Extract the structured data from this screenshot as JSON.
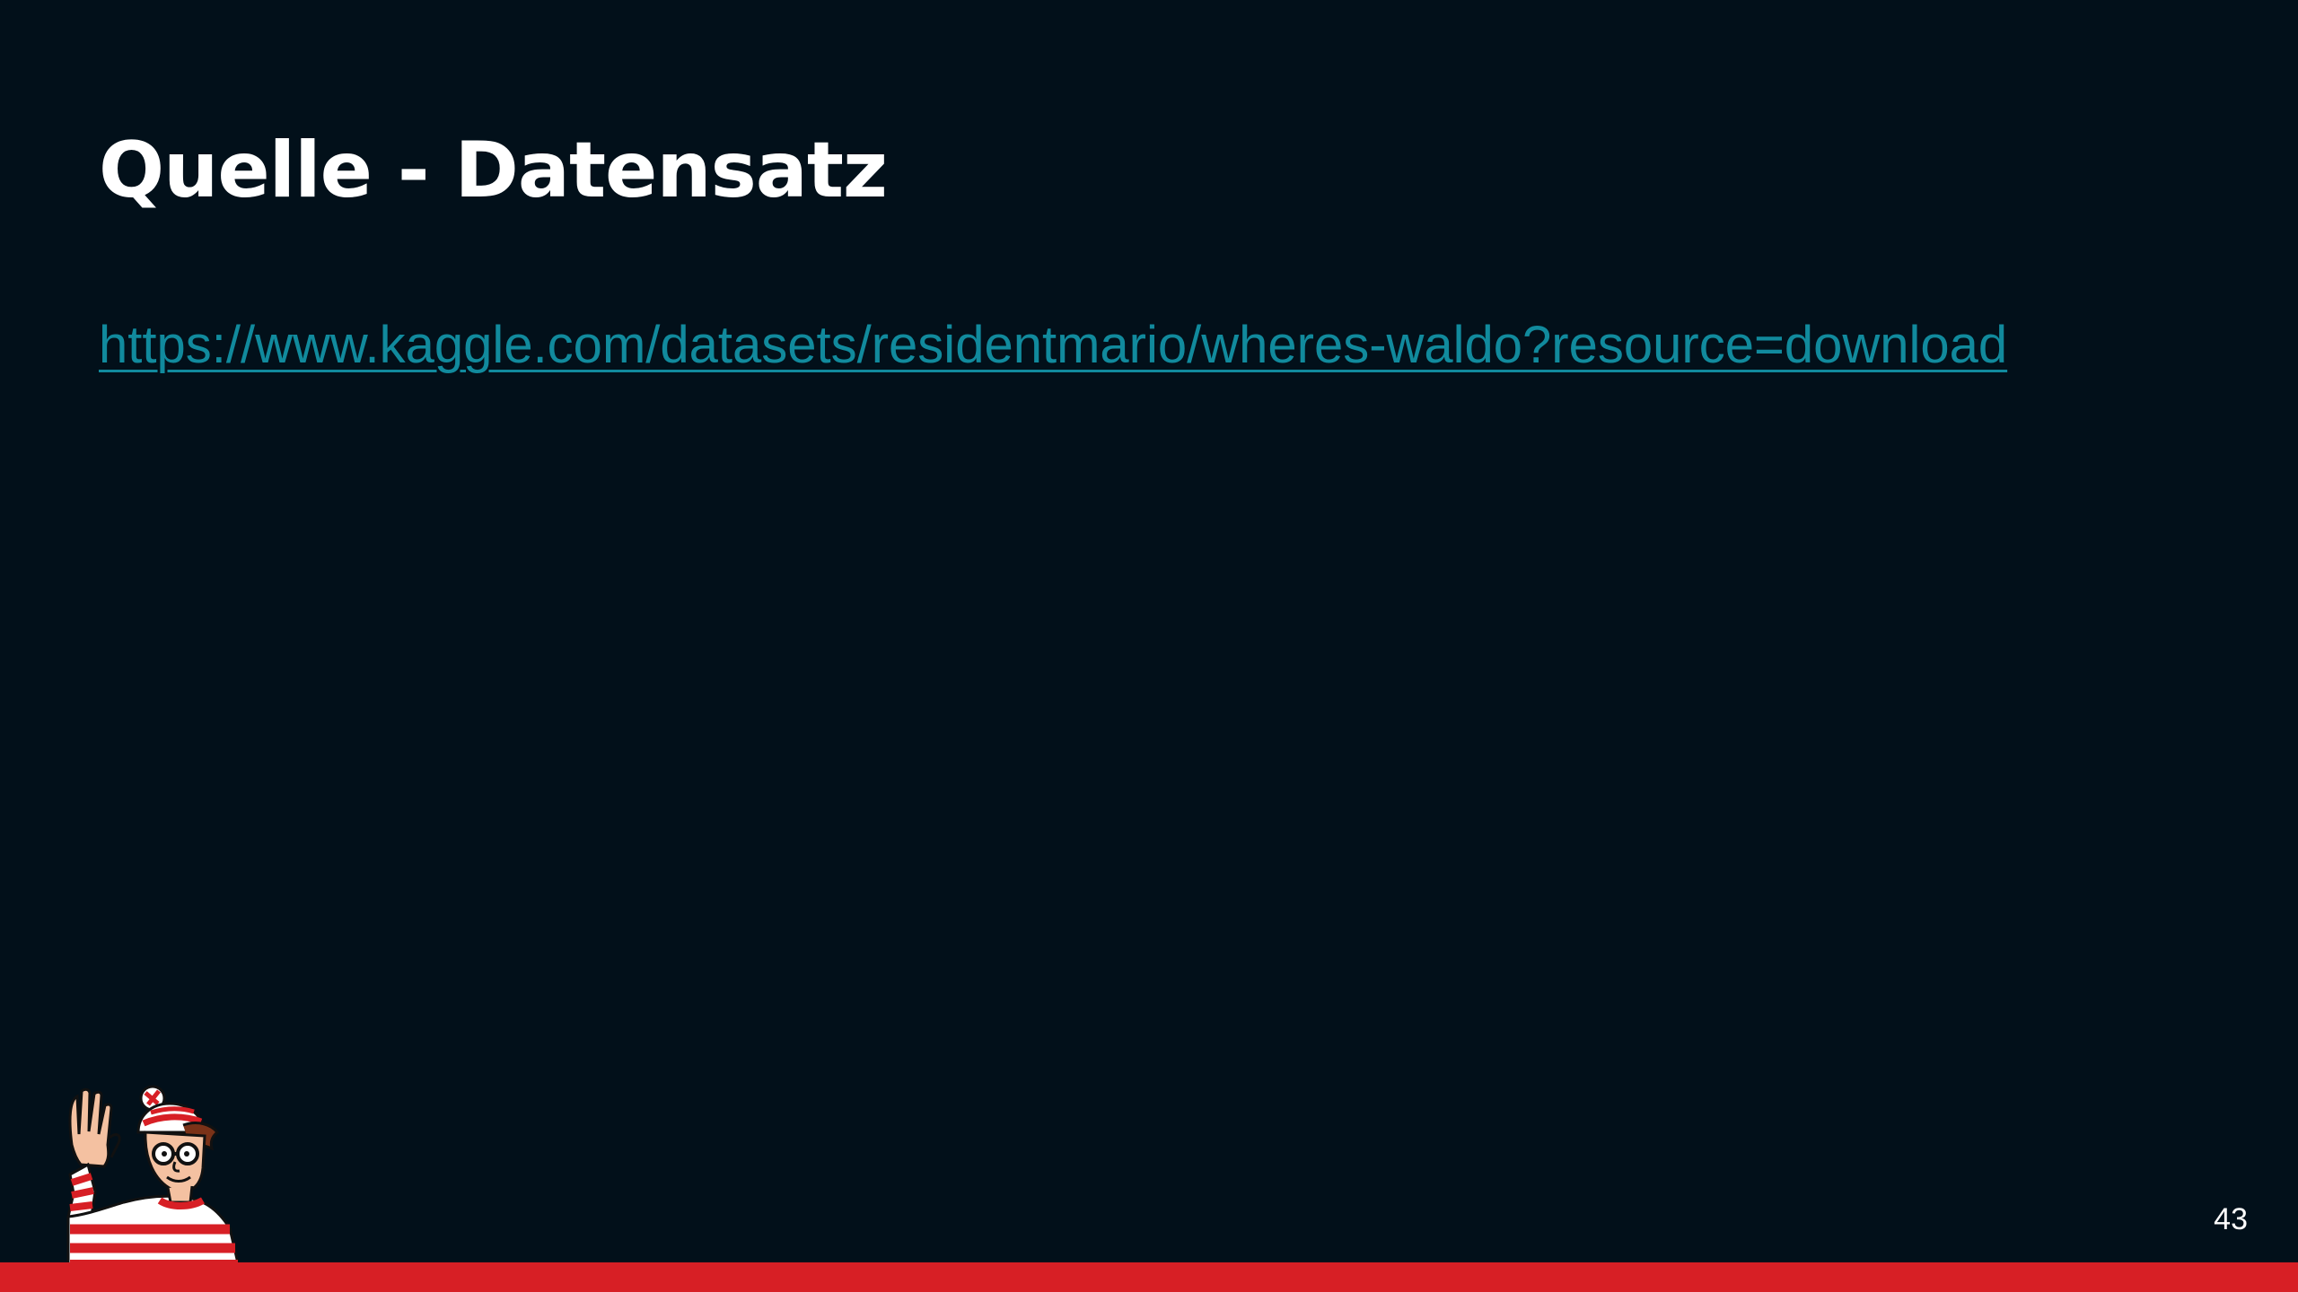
{
  "slide": {
    "title": "Quelle - Datensatz",
    "link_text": "https://www.kaggle.com/datasets/residentmario/wheres-waldo?resource=download",
    "link_href": "https://www.kaggle.com/datasets/residentmario/wheres-waldo?resource=download",
    "page_number": "43"
  },
  "colors": {
    "background": "#02101a",
    "title": "#ffffff",
    "link": "#118a9d",
    "accent_bar": "#d71f25"
  },
  "icons": {
    "mascot": "waldo-waving-icon"
  }
}
